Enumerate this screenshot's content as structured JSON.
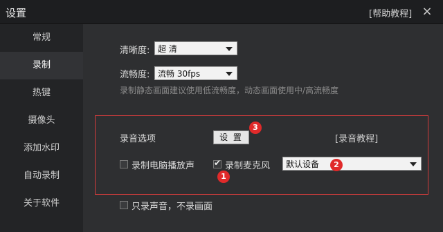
{
  "window": {
    "title": "设置",
    "help_link": "[帮助教程]",
    "close_glyph": "×"
  },
  "sidebar": {
    "items": [
      {
        "label": "常规",
        "active": false
      },
      {
        "label": "录制",
        "active": true
      },
      {
        "label": "热键",
        "active": false
      },
      {
        "label": "摄像头",
        "active": false
      },
      {
        "label": "添加水印",
        "active": false
      },
      {
        "label": "自动录制",
        "active": false
      },
      {
        "label": "关于软件",
        "active": false
      }
    ]
  },
  "main": {
    "clarity": {
      "label": "清晰度:",
      "value": "超 清"
    },
    "fluency": {
      "label": "流畅度:",
      "value": "流畅 30fps"
    },
    "hint": "录制静态画面建议使用低流畅度，动态画面使用中/高流畅度",
    "audio": {
      "label": "录音选项",
      "settings_button": "设 置",
      "tutorial_link": "[录音教程]",
      "system_audio": {
        "label": "录制电脑播放声",
        "checked": false
      },
      "microphone": {
        "label": "录制麦克风",
        "checked": true
      },
      "device": {
        "value": "默认设备"
      },
      "badges": [
        "1",
        "2",
        "3"
      ]
    },
    "audio_only": {
      "label": "只录声音，不录画面",
      "checked": false
    }
  },
  "colors": {
    "accent_red": "#e02a2a",
    "box_border": "#d43c3c"
  }
}
